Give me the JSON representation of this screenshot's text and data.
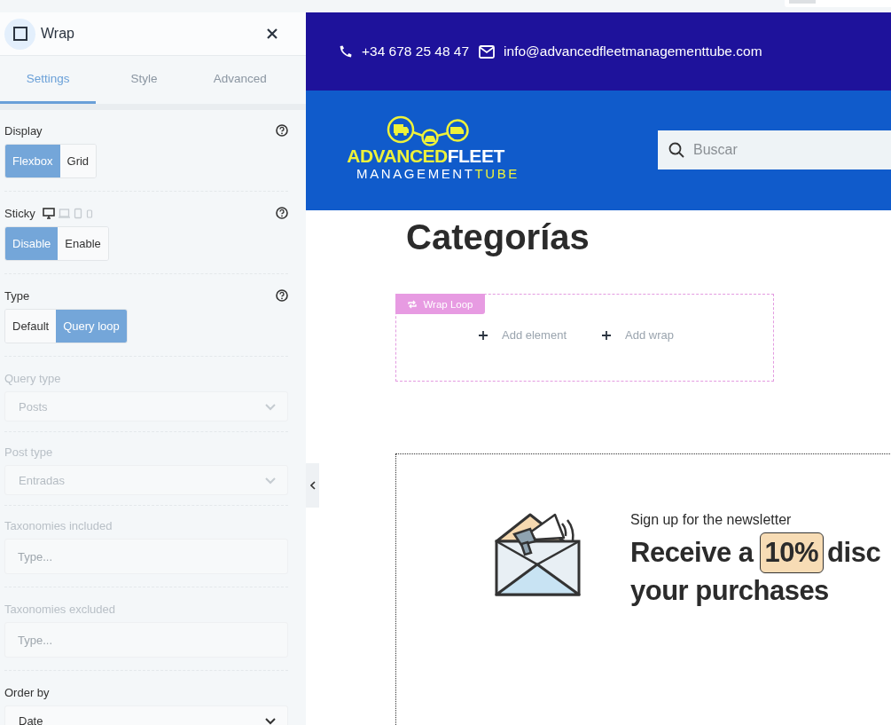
{
  "panel": {
    "title": "Wrap",
    "tabs": [
      {
        "label": "Settings",
        "selected": true
      },
      {
        "label": "Style",
        "selected": false
      },
      {
        "label": "Advanced",
        "selected": false
      }
    ],
    "sections": [
      {
        "kind": "toggle",
        "label": "Display",
        "help": true,
        "options": [
          {
            "label": "Flexbox",
            "selected": true
          },
          {
            "label": "Grid",
            "selected": false
          }
        ]
      },
      {
        "kind": "toggle",
        "label": "Sticky",
        "help": true,
        "devices": [
          {
            "kind": "desktop",
            "selected": true
          },
          {
            "kind": "laptop",
            "selected": false
          },
          {
            "kind": "tablet",
            "selected": false
          },
          {
            "kind": "mobile",
            "selected": false
          }
        ],
        "options": [
          {
            "label": "Disable",
            "selected": true
          },
          {
            "label": "Enable",
            "selected": false
          }
        ]
      },
      {
        "kind": "toggle",
        "label": "Type",
        "help": true,
        "options": [
          {
            "label": "Default",
            "selected": false
          },
          {
            "label": "Query loop",
            "selected": true
          }
        ]
      },
      {
        "kind": "select",
        "label": "Query type",
        "value": "Posts",
        "disabled": true
      },
      {
        "kind": "select",
        "label": "Post type",
        "value": "Entradas",
        "disabled": true
      },
      {
        "kind": "text",
        "label": "Taxonomies included",
        "placeholder": "Type...",
        "disabled": true
      },
      {
        "kind": "text",
        "label": "Taxonomies excluded",
        "placeholder": "Type...",
        "disabled": true
      },
      {
        "kind": "select",
        "label": "Order by",
        "value": "Date",
        "disabled": false
      }
    ]
  },
  "site": {
    "phone": "+34 678 25 48 47",
    "email": "info@advancedfleetmanagementtube.com",
    "logo": {
      "lines": [
        [
          {
            "text": "ADVANCED",
            "accent": true
          },
          {
            "text": "FLEET",
            "accent": false
          }
        ],
        [
          {
            "text": "MANAGEMENT",
            "accent": false
          },
          {
            "text": "TUBE",
            "accent": true
          }
        ]
      ]
    },
    "search": {
      "placeholder": "Buscar"
    },
    "heading": "Categorías",
    "wrap_loop": {
      "badge": "Wrap Loop",
      "actions": [
        "Add element",
        "Add wrap"
      ]
    },
    "newsletter": {
      "eyebrow": "Sign up for the newsletter",
      "headline_start": "Receive a",
      "highlight": "10%",
      "headline_end": "disc",
      "headline_line_2": "your purchases"
    }
  }
}
